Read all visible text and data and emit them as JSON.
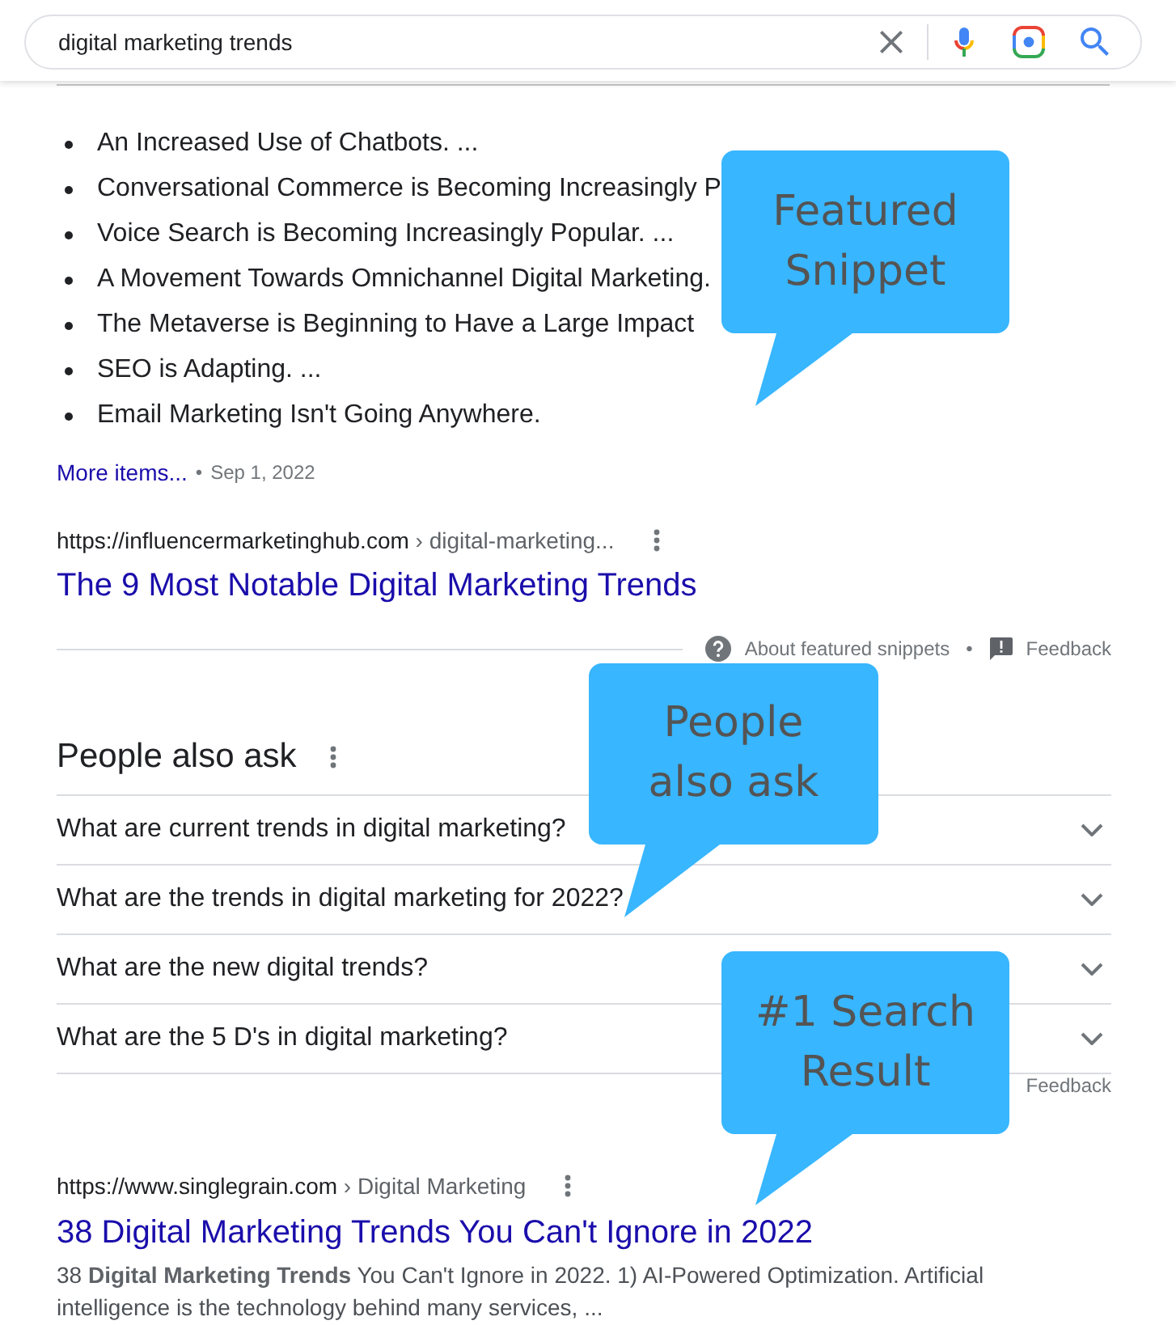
{
  "search": {
    "value": "digital marketing trends"
  },
  "featured_snippet": {
    "items": [
      "An Increased Use of Chatbots. ...",
      "Conversational Commerce is Becoming Increasingly P",
      "Voice Search is Becoming Increasingly Popular. ...",
      "A Movement Towards Omnichannel Digital Marketing.",
      "The Metaverse is Beginning to Have a Large Impact",
      "SEO is Adapting. ...",
      "Email Marketing Isn't Going Anywhere."
    ],
    "more_link": "More items...",
    "separator": "•",
    "date": "Sep 1, 2022",
    "source": {
      "url": "https://influencermarketinghub.com",
      "breadcrumb": "› digital-marketing...",
      "title": "The 9 Most Notable Digital Marketing Trends"
    },
    "footer": {
      "about": "About featured snippets",
      "separator": "•",
      "feedback": "Feedback"
    },
    "callout": "Featured Snippet"
  },
  "people_also_ask": {
    "heading": "People also ask",
    "questions": [
      {
        "text": "What are current trends in digital marketing?",
        "expanded": false
      },
      {
        "text": "What are the trends in digital marketing for 2022?",
        "expanded": false
      },
      {
        "text": "What are the new digital trends?",
        "expanded": false
      },
      {
        "text": "What are the 5 D's in digital marketing?",
        "expanded": false
      }
    ],
    "feedback": "Feedback",
    "callout": "People also ask"
  },
  "results": [
    {
      "url": "https://www.singlegrain.com",
      "breadcrumb": "› Digital Marketing",
      "title": "38 Digital Marketing Trends You Can't Ignore in 2022",
      "snippet": "38 **Digital Marketing Trends** You Can't Ignore in 2022. 1) AI-Powered Optimization. Artificial intelligence is the technology behind many services, ...",
      "callout": "#1 Search Result"
    }
  ]
}
